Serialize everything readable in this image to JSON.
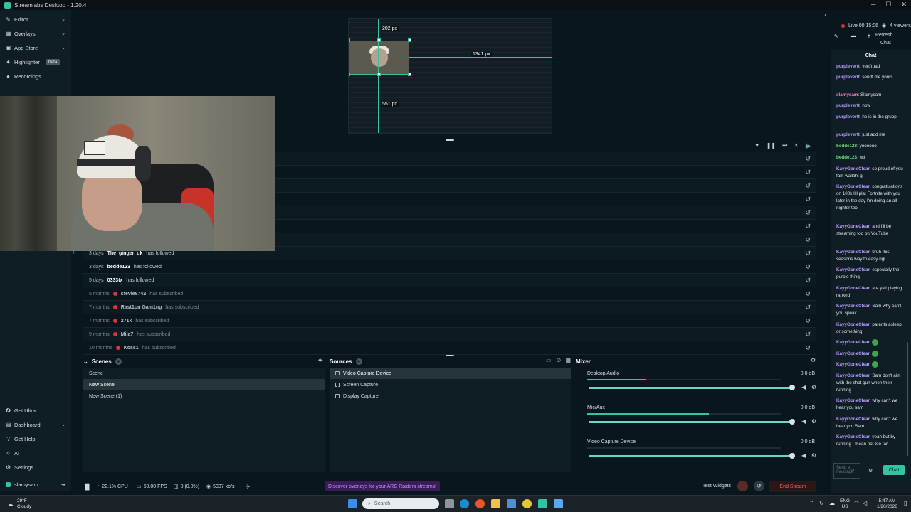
{
  "window": {
    "title": "Streamlabs Desktop - 1.20.4",
    "controls": [
      "─",
      "☐",
      "✕"
    ]
  },
  "sidebar": {
    "items": [
      {
        "label": "Editor",
        "icon": "pencil-icon",
        "chevron": "⌄"
      },
      {
        "label": "Overlays",
        "icon": "overlays-icon",
        "chevron": "⌄"
      },
      {
        "label": "App Store",
        "icon": "store-icon",
        "chevron": "⌄"
      },
      {
        "label": "Highlighter",
        "icon": "highlighter-icon",
        "badge": "beta"
      },
      {
        "label": "Recordings",
        "icon": "record-icon"
      }
    ],
    "bottom_items": [
      {
        "label": "Get Ultra",
        "icon": "ultra-icon"
      },
      {
        "label": "Dashboard",
        "icon": "dashboard-icon",
        "chevron": "⌄"
      },
      {
        "label": "Get Help",
        "icon": "help-icon"
      },
      {
        "label": "AI",
        "icon": "ai-icon"
      },
      {
        "label": "Settings",
        "icon": "gear-icon"
      }
    ],
    "user": {
      "name": "slamysam"
    }
  },
  "preview": {
    "width_label": "202 px",
    "right_label": "1341 px",
    "bottom_label": "551 px"
  },
  "activity": {
    "rows": [
      {
        "time": "3 days",
        "name": "The_ginger_dk",
        "action": "has followed",
        "badge": false,
        "dim": false
      },
      {
        "time": "3 days",
        "name": "bedde123",
        "action": "has followed",
        "badge": false,
        "dim": false
      },
      {
        "time": "5 days",
        "name": "0333tx",
        "action": "has followed",
        "badge": false,
        "dim": false
      },
      {
        "time": "5 months",
        "name": "stevie8742",
        "action": "has subscribed",
        "badge": true,
        "dim": true
      },
      {
        "time": "7 months",
        "name": "Rast1on Gam1ng",
        "action": "has subscribed",
        "badge": true,
        "dim": true
      },
      {
        "time": "7 months",
        "name": "271k",
        "action": "has subscribed",
        "badge": true,
        "dim": true
      },
      {
        "time": "9 months",
        "name": "Mila7",
        "action": "has subscribed",
        "badge": true,
        "dim": true
      },
      {
        "time": "10 months",
        "name": "Koss1",
        "action": "has subscribed",
        "badge": true,
        "dim": true
      }
    ]
  },
  "scenes": {
    "header": "Scenes",
    "items": [
      "Scene",
      "New Scene",
      "New Scene (1)"
    ],
    "selected": 1
  },
  "sources": {
    "header": "Sources",
    "items": [
      "Video Capture Device",
      "Screen Capture",
      "Display Capture"
    ],
    "selected": 0
  },
  "mixer": {
    "header": "Mixer",
    "items": [
      {
        "name": "Desktop Audio",
        "db": "0.0 dB",
        "level": 0.3
      },
      {
        "name": "Mic/Aux",
        "db": "0.0 dB",
        "level": 0.63
      },
      {
        "name": "Video Capture Device",
        "db": "0.0 dB",
        "level": 0
      }
    ]
  },
  "status": {
    "cpu": "22.1% CPU",
    "fps": "60.00 FPS",
    "dropped": "0 (0.0%)",
    "bitrate": "5037 kb/s",
    "promo": "Discover overlays for your ARC Raiders streams!",
    "test_widgets": "Test Widgets",
    "end_stream": "End Stream"
  },
  "live": {
    "time": "Live 00:15:06",
    "viewers": "4 viewers",
    "refresh_line1": "Refresh",
    "refresh_line2": "Chat",
    "chat_title": "Chat"
  },
  "chat": {
    "messages": [
      {
        "user": "purplevertt",
        "text": "vertfruad",
        "color": "#b99cff"
      },
      {
        "user": "purplevertt",
        "text": "sendf me yours",
        "color": "#b99cff"
      },
      {
        "user": "slamysam",
        "text": "Slamysam",
        "color": "#ff7fd0"
      },
      {
        "user": "purplevertt",
        "text": "now",
        "color": "#b99cff"
      },
      {
        "user": "purplevertt",
        "text": "he is in the gruop",
        "color": "#b99cff"
      },
      {
        "user": "purplevertt",
        "text": "just add me",
        "color": "#b99cff"
      },
      {
        "user": "bedde123",
        "text": "yoooooo",
        "color": "#67e37d"
      },
      {
        "user": "bedde123",
        "text": "wtf",
        "color": "#67e37d"
      },
      {
        "user": "KayyGoneClear",
        "text": "so proud of you fam wallahi g",
        "color": "#b99cff"
      },
      {
        "user": "KayyGoneClear",
        "text": "congratulations on 100k I'll plat Fortnite with you later in the day I'm doing an all nighter too",
        "color": "#b99cff"
      },
      {
        "user": "KayyGoneClear",
        "text": "and I'll be streaming too on YouTube",
        "color": "#b99cff"
      },
      {
        "user": "KayyGoneClear",
        "text": "bruh this seasons way to easy ngl",
        "color": "#b99cff"
      },
      {
        "user": "KayyGoneClear",
        "text": "especially the purple thing",
        "color": "#b99cff"
      },
      {
        "user": "KayyGoneClear",
        "text": "are yall playing ranked",
        "color": "#b99cff"
      },
      {
        "user": "KayyGoneClear",
        "text": "Sam why can't you speak",
        "color": "#b99cff"
      },
      {
        "user": "KayyGoneClear",
        "text": "parents asleep or something",
        "color": "#b99cff"
      },
      {
        "user": "KayyGoneClear",
        "text": "",
        "color": "#b99cff"
      },
      {
        "user": "KayyGoneClear",
        "text": "",
        "color": "#b99cff"
      },
      {
        "user": "KayyGoneClear",
        "text": "",
        "color": "#b99cff"
      },
      {
        "user": "KayyGoneClear",
        "text": "Sam don't aim with the shot gun when their running",
        "color": "#b99cff"
      },
      {
        "user": "KayyGoneClear",
        "text": "why can't we hear you sam",
        "color": "#b99cff"
      },
      {
        "user": "KayyGoneClear",
        "text": "why can't we hear you Sam",
        "color": "#b99cff"
      },
      {
        "user": "KayyGoneClear",
        "text": "yeah but by running I mean not too far",
        "color": "#b99cff"
      }
    ],
    "input_placeholder": "Send a message",
    "send_label": "Chat"
  },
  "taskbar": {
    "temp": "29°F",
    "condition": "Cloudy",
    "search_placeholder": "Search",
    "lang_line1": "ENG",
    "lang_line2": "US",
    "time": "5:47 AM",
    "date": "1/20/2026"
  },
  "colors": {
    "accent": "#31c3a2",
    "live": "#e0323a",
    "end_stream": "#ff5a5a",
    "promo": "#c58cff"
  }
}
